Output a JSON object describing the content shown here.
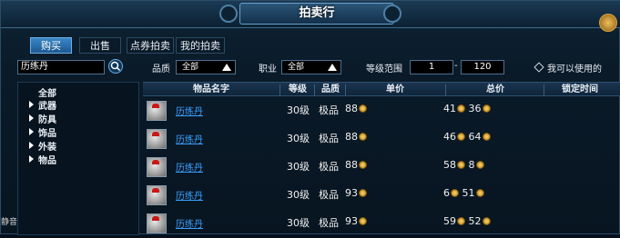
{
  "window": {
    "title": "拍卖行"
  },
  "tabs": [
    {
      "label": "购买",
      "active": true
    },
    {
      "label": "出售",
      "active": false
    },
    {
      "label": "点券拍卖",
      "active": false
    },
    {
      "label": "我的拍卖",
      "active": false
    }
  ],
  "search": {
    "value": "历练丹",
    "quality_label": "品质",
    "quality_value": "全部",
    "class_label": "职业",
    "class_value": "全部",
    "level_label": "等级范围",
    "level_min": "1",
    "level_sep": "-",
    "level_max": "120",
    "usable_label": "我可以使用的"
  },
  "categories": [
    {
      "label": "全部",
      "arrow": false
    },
    {
      "label": "武器",
      "arrow": true
    },
    {
      "label": "防具",
      "arrow": true
    },
    {
      "label": "饰品",
      "arrow": true
    },
    {
      "label": "外装",
      "arrow": true
    },
    {
      "label": "物品",
      "arrow": true
    }
  ],
  "table": {
    "columns": [
      "物品名字",
      "等级",
      "品质",
      "单价",
      "总价",
      "锁定时间"
    ],
    "rows": [
      {
        "name": "历练丹",
        "level": "30级",
        "quality": "极品",
        "unit": "88",
        "total_a": "41",
        "total_b": "36"
      },
      {
        "name": "历练丹",
        "level": "30级",
        "quality": "极品",
        "unit": "88",
        "total_a": "46",
        "total_b": "64"
      },
      {
        "name": "历练丹",
        "level": "30级",
        "quality": "极品",
        "unit": "88",
        "total_a": "58",
        "total_b": "8"
      },
      {
        "name": "历练丹",
        "level": "30级",
        "quality": "极品",
        "unit": "93",
        "total_a": "6",
        "total_b": "51"
      },
      {
        "name": "历练丹",
        "level": "30级",
        "quality": "极品",
        "unit": "93",
        "total_a": "59",
        "total_b": "52"
      }
    ]
  },
  "edge_text": "静音",
  "colors": {
    "link": "#3aa0ff",
    "tab_active": "#2a72b4",
    "coin": "#e0a830"
  }
}
